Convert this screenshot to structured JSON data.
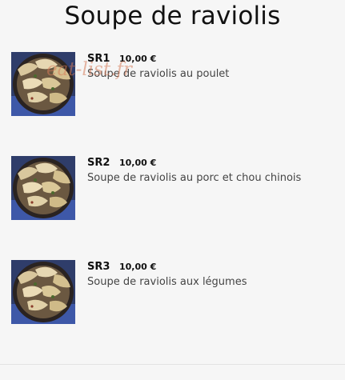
{
  "page": {
    "title": "Soupe de raviolis"
  },
  "items": [
    {
      "code": "SR1",
      "price": "10,00 €",
      "name": "Soupe de raviolis au poulet"
    },
    {
      "code": "SR2",
      "price": "10,00 €",
      "name": "Soupe de raviolis au porc et chou chinois"
    },
    {
      "code": "SR3",
      "price": "10,00 €",
      "name": "Soupe de raviolis aux légumes"
    }
  ],
  "watermark": "eat-list.fr",
  "colors": {
    "background": "#f6f6f6",
    "title": "#111111",
    "text": "#444444",
    "watermark": "#d67c5a"
  },
  "icons": {
    "dish_image": "dumpling-soup-photo"
  }
}
